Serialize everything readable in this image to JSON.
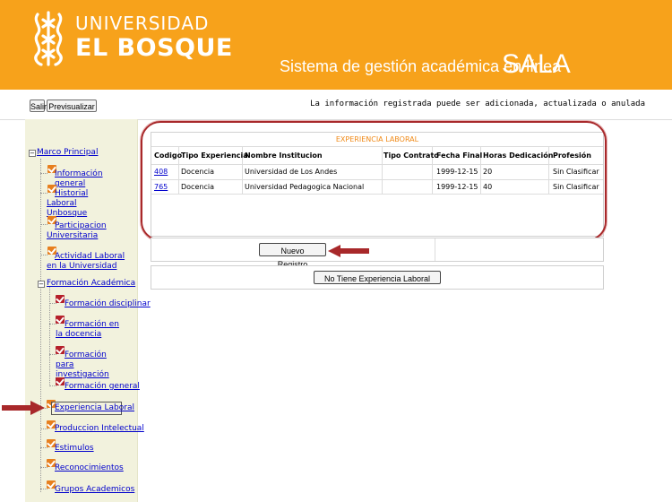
{
  "header": {
    "brand_top": "UNIVERSIDAD",
    "brand_bottom": "EL BOSQUE",
    "system_title": "Sistema de gestión académica en línea",
    "system_name": "SALA",
    "background_color": "#f7a21b"
  },
  "toolbar": {
    "salir_label": "Salir",
    "previsualizar_label": "Previsualizar",
    "info_text": "La información registrada puede ser adicionada, actualizada o anulada"
  },
  "sidebar": {
    "root_label": "Marco Principal",
    "items": [
      {
        "label": "Información general"
      },
      {
        "label": "Historial Laboral Unbosque"
      },
      {
        "label": "Participacion Universitaria"
      },
      {
        "label": "Actividad Laboral en la Universidad"
      }
    ],
    "formacion": {
      "label": "Formación Académica",
      "children": [
        {
          "label": "Formación disciplinar"
        },
        {
          "label": "Formación en la docencia"
        },
        {
          "label": "Formación para investigación"
        },
        {
          "label": "Formación general"
        }
      ]
    },
    "more_items": [
      {
        "label": "Experiencia Laboral"
      },
      {
        "label": "Produccion Intelectual"
      },
      {
        "label": "Estimulos"
      },
      {
        "label": "Reconocimientos"
      },
      {
        "label": "Grupos Academicos"
      }
    ]
  },
  "experiencia": {
    "title": "EXPERIENCIA LABORAL",
    "columns": [
      "Codigo",
      "Tipo Experiencia",
      "Nombre Institucion",
      "Tipo Contrato",
      "Fecha Final",
      "Horas Dedicación",
      "Profesión"
    ],
    "rows": [
      {
        "codigo": "408",
        "tipo": "Docencia",
        "institucion": "Universidad de Los Andes",
        "contrato": "",
        "fecha": "1999-12-15",
        "horas": "20",
        "profesion": "Sin Clasificar"
      },
      {
        "codigo": "765",
        "tipo": "Docencia",
        "institucion": "Universidad Pedagogica Nacional",
        "contrato": "",
        "fecha": "1999-12-15",
        "horas": "40",
        "profesion": "Sin Clasificar"
      }
    ]
  },
  "actions": {
    "nuevo_registro": "Nuevo Registro",
    "no_tiene": "No Tiene Experiencia Laboral"
  },
  "colors": {
    "accent_orange": "#f08a18",
    "highlight_red": "#a8282a",
    "link_blue": "#0000cc"
  }
}
